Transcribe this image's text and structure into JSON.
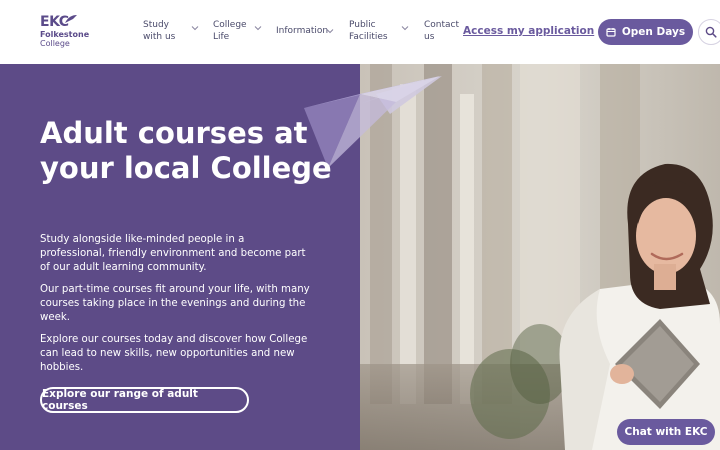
{
  "logo": {
    "mark": "EKC",
    "line1": "Folkestone",
    "line2": "College"
  },
  "nav": {
    "items": [
      {
        "label": "Study with us"
      },
      {
        "label": "College Life"
      },
      {
        "label": "Information"
      },
      {
        "label": "Public Facilities"
      },
      {
        "label": "Contact us"
      }
    ],
    "access_link": "Access my application",
    "open_days_label": "Open Days"
  },
  "hero": {
    "title": "Adult courses at your local College",
    "paragraphs": [
      "Study alongside like-minded people in a professional, friendly environment and become part of our adult learning community.",
      "Our part-time courses fit around your life, with many courses taking place in the evenings and during the week.",
      "Explore our courses today and discover how College can lead to new skills, new opportunities and new hobbies."
    ],
    "cta_label": "Explore our range of adult courses"
  },
  "chat": {
    "label": "Chat with EKC"
  },
  "colors": {
    "brand_purple": "#6a5a9e",
    "hero_purple": "#5d4b87",
    "nav_text": "#4b4b6b"
  },
  "icons": [
    "chevron-down-icon",
    "calendar-icon",
    "search-icon",
    "paper-plane-graphic"
  ]
}
